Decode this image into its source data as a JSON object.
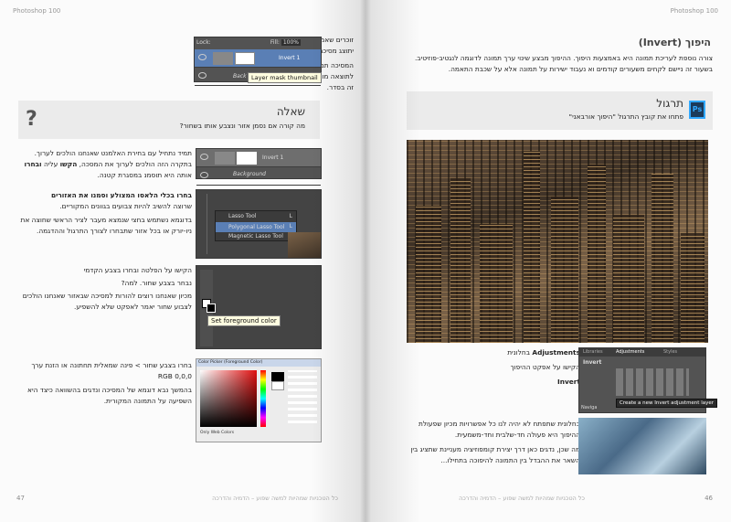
{
  "book_title": "Photoshop 100",
  "left_page": {
    "page_number": "47",
    "footer": "כל הטכניות שמהיות למשה שפוע – הדמיה והדרכה",
    "intro_paragraphs": [
      "זוכרים שאמרנו שכבל פעם שניגשים שכבת התאמה יתוצג מסיכה אוטומטית? מעולה!",
      "המסיכה תמיד תתחיל לבנה לגמרי – כלומר, היא לתוצאה מורה לאפקט להשפיע הזו שהמסכה לבנה זה בסדר."
    ],
    "layers_panel_1": {
      "lock_label": "Lock:",
      "fill_label": "Fill:",
      "fill_value": "100%",
      "layer_1": "Invert 1",
      "layer_2": "Back",
      "tooltip": "Layer mask thumbnail"
    },
    "question": {
      "title": "שאלה",
      "text": "מה קורה אם נסמן אזור ונצבע אותו בשחור?"
    },
    "step1": {
      "text_a": "תמיד נתחיל עם בחירת האלמנט שאנחנו הולכים לערוך. בתקרה הזה הולכים לערוך את המסכה,",
      "bold_a": "הקשו",
      "text_b": "עליה",
      "bold_b": "ובחרו",
      "text_c": "אותה היא תוסמנ במסגרת קטנה."
    },
    "layers_panel_2": {
      "layer_1": "Invert 1",
      "layer_2": "Background"
    },
    "step2": {
      "bold": "בחרו בכלי הלאסו המצולע וסמנו את האזורים",
      "text": "שרוצה להשיב להיות צבועים בגוונים המקוריים.",
      "text2": "בדוגמא נשתמש בחצי שנמצא מעבר לציר הראשי שחוצה את ניו-יורק או בכל אזור שתבחרו לצורך התרגול וההדגמה."
    },
    "lasso_menu": [
      "Lasso Tool",
      "Polygonal Lasso Tool",
      "Magnetic Lasso Tool"
    ],
    "lasso_key": "L",
    "step3": {
      "line1": "הקישו על הפלטה ובחרו בצבע הקדמי",
      "line2": "נבחר בצבע שחור. למה?",
      "line3": "מכיון שאנחנו רוצים להורות למסיכה שבאזור שאנחנו הולכים לצבוע שחור יאמר לאפקט שלא להשפיע."
    },
    "fg_tooltip": "Set foreground color",
    "step4": {
      "line1": "בחרו בצבע שחור > פינה שמאלית תחתונה או הזנת ערך",
      "line2": "RGB 0,0,0",
      "line3": "בהמשך נבא דוגמא של המסיכה ונדגים בהשוואה כיצד היא השפיעה על התמונה המקורית."
    },
    "color_picker_title": "Color Picker (Foreground Color)",
    "color_picker_footer": "Only Web Colors"
  },
  "right_page": {
    "page_number": "46",
    "footer": "כל הטכניות שמהיות למשה שפוע – הדמיה והדרכה",
    "title": "היפוך (Invert)",
    "intro": "צורה נוספת לעריכת תמונה היא באמצעות היפוך. ההיפוך מבצע שינוי ערך תמונה לדוגמה לנגטיב-פוזיטיב. בשעור זה ניישם לקחים משעורים קודמים וא נעבוד ישירות על תמונה אלא על שכבת התאמה.",
    "exercise": {
      "title": "תרגול",
      "text": "פתחו את קובץ התרגול \"היפוך אורבאני\"",
      "icon_label": "Ps"
    },
    "adjustments": {
      "prefix": "בחלונית",
      "bold": "Adjustments",
      "line2": "הקישו על אפקט ההיפוך",
      "line3": "Invert"
    },
    "adj_panel": {
      "tabs": [
        "Libraries",
        "Adjustments",
        "Styles"
      ],
      "panel_title": "Invert",
      "tooltip": "Create a new Invert adjustment layer",
      "nav_label": "Naviga"
    },
    "result_text": [
      "בחלונית שתפתח לא יהיה לנו כל אפשרויות מכיון שפעולת ההיפוך היא פעולה חד-שלבית וחד-משמעית.",
      "מה שכן, נדגים כאן דרך יצירת קומפוזיציה מעניינת שתציג בין השאר את ההבדל בין התמונה להיפוכה בתחילו..."
    ]
  }
}
